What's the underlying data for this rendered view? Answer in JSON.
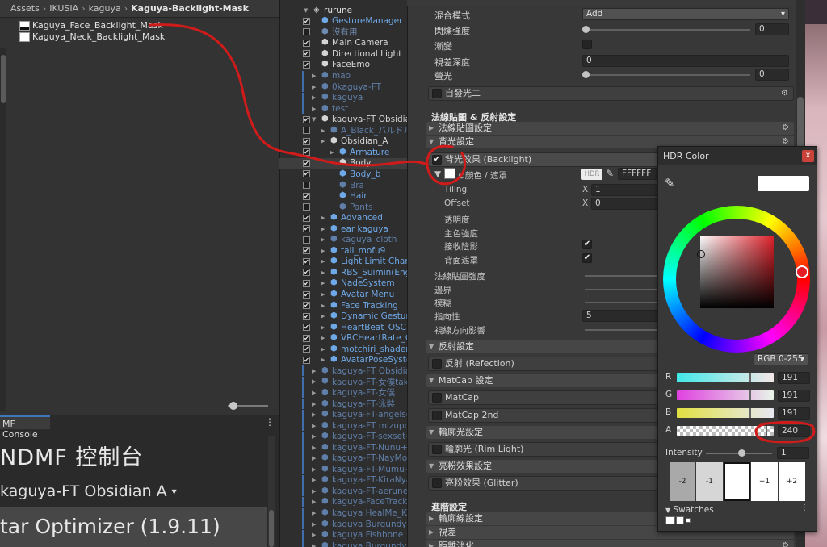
{
  "project": {
    "breadcrumb": [
      "Assets",
      "IKUSIA",
      "kaguya",
      "Kaguya-Backlight-Mask"
    ],
    "assets": [
      "Kaguya_Face_Backlight_Mask",
      "Kaguya_Neck_Backlight_Mask"
    ]
  },
  "console": {
    "tab": "MF Console",
    "title": "NDMF 控制台",
    "selected_avatar": "kaguya-FT Obsidian  A",
    "banner": "tar Optimizer (1.9.11)",
    "menu_icon": "kebab-menu-icon"
  },
  "hierarchy": {
    "root": "rurune",
    "rows": [
      {
        "label": "GestureManager",
        "color": "#6fa8e6",
        "check": true
      },
      {
        "label": "沒有用",
        "color": "#6f8bb0",
        "check": false
      },
      {
        "label": "Main Camera",
        "color": "#d4d4d4",
        "check": true
      },
      {
        "label": "Directional Light",
        "color": "#d4d4d4",
        "check": true
      },
      {
        "label": "FaceEmo",
        "color": "#d4d4d4",
        "check": true
      },
      {
        "label": "mao",
        "color": "#5f7ea8",
        "check": false
      },
      {
        "label": "0kaguya-FT",
        "color": "#5f7ea8",
        "check": false
      },
      {
        "label": "kaguya",
        "color": "#5f7ea8",
        "check": false
      },
      {
        "label": "test",
        "color": "#5f7ea8",
        "check": false
      },
      {
        "label": "kaguya-FT Obsidian",
        "color": "#d4d4d4",
        "check": true
      },
      {
        "label": "A_Black_バルドル",
        "color": "#5f7ea8",
        "check": false
      },
      {
        "label": "Obsidian_A",
        "color": "#d4d4d4",
        "check": true
      },
      {
        "label": "Armature",
        "color": "#6fa8e6",
        "check": true
      },
      {
        "label": "Body",
        "color": "#d4d4d4",
        "check": true
      },
      {
        "label": "Body_b",
        "color": "#6fa8e6",
        "check": true
      },
      {
        "label": "Bra",
        "color": "#5f7ea8",
        "check": false
      },
      {
        "label": "Hair",
        "color": "#6fa8e6",
        "check": true
      },
      {
        "label": "Pants",
        "color": "#5f7ea8",
        "check": false
      },
      {
        "label": "Advanced",
        "color": "#6fa8e6",
        "check": true
      },
      {
        "label": "ear kaguya",
        "color": "#6fa8e6",
        "check": true
      },
      {
        "label": "kaguya_cloth",
        "color": "#5f7ea8",
        "check": false
      },
      {
        "label": "tail_mofu9",
        "color": "#6fa8e6",
        "check": true
      },
      {
        "label": "Light Limit Chang",
        "color": "#6fa8e6",
        "check": true
      },
      {
        "label": "RBS_Suimin(Engl",
        "color": "#6fa8e6",
        "check": true
      },
      {
        "label": "NadeSystem",
        "color": "#6fa8e6",
        "check": true
      },
      {
        "label": "Avatar Menu",
        "color": "#6fa8e6",
        "check": true
      },
      {
        "label": "Face Tracking",
        "color": "#6fa8e6",
        "check": true
      },
      {
        "label": "Dynamic Gesture",
        "color": "#6fa8e6",
        "check": true
      },
      {
        "label": "HeartBeat_OSC",
        "color": "#6fa8e6",
        "check": true
      },
      {
        "label": "VRCHeartRate_C",
        "color": "#6fa8e6",
        "check": true
      },
      {
        "label": "motchiri_shader_S",
        "color": "#6fa8e6",
        "check": true
      },
      {
        "label": "AvatarPoseSyste",
        "color": "#6fa8e6",
        "check": true
      },
      {
        "label": "kaguya-FT Obsidia",
        "color": "#5f7ea8",
        "check": false
      },
      {
        "label": "kaguya-FT-女僕tak",
        "color": "#5f7ea8",
        "check": false
      },
      {
        "label": "kaguya-FT-女僕",
        "color": "#5f7ea8",
        "check": false
      },
      {
        "label": "kaguya-FT-泳裝",
        "color": "#5f7ea8",
        "check": false
      },
      {
        "label": "kaguya-FT-angelsc",
        "color": "#5f7ea8",
        "check": false
      },
      {
        "label": "kaguya-FT mizupoy",
        "color": "#5f7ea8",
        "check": false
      },
      {
        "label": "kaguya-FT-sexset-",
        "color": "#5f7ea8",
        "check": false
      },
      {
        "label": "kaguya-FT-Nunu+I",
        "color": "#5f7ea8",
        "check": false
      },
      {
        "label": "kaguya-FT-NayMo",
        "color": "#5f7ea8",
        "check": false
      },
      {
        "label": "kaguya-FT-Mumu-",
        "color": "#5f7ea8",
        "check": false
      },
      {
        "label": "kaguya-FT-KiraNya",
        "color": "#5f7ea8",
        "check": false
      },
      {
        "label": "kaguya-FT-aerune",
        "color": "#5f7ea8",
        "check": false
      },
      {
        "label": "kaguya-FaceTrack",
        "color": "#5f7ea8",
        "check": false
      },
      {
        "label": "kaguya HealMe_Ka",
        "color": "#5f7ea8",
        "check": false
      },
      {
        "label": "kaguya Burgundy",
        "color": "#5f7ea8",
        "check": false
      },
      {
        "label": "kaguya Fishbone",
        "color": "#5f7ea8",
        "check": false
      },
      {
        "label": "kaguya Burgundy-",
        "color": "#5f7ea8",
        "check": false
      }
    ]
  },
  "inspector": {
    "blend_mode_label": "混合模式",
    "blend_mode_value": "Add",
    "blink_label": "閃爍強度",
    "blink_value": "0",
    "fade_label": "漸變",
    "parallax_label": "視差深度",
    "parallax_value": "0",
    "fluor_label": "螢光",
    "fluor_value": "0",
    "emission2": "自發光二",
    "normal_heading": "法線貼圖 & 反射設定",
    "normal_section": "法線貼圖設定",
    "backlight_section": "背光設定",
    "backlight_toggle": "背光效果 (Backlight)",
    "color_mask_label": "顏色 / 遮罩",
    "hdr_badge": "HDR",
    "hex_value": "FFFFFF",
    "tiling_label": "Tiling",
    "tiling_x": "X",
    "tiling_value": "1",
    "offset_label": "Offset",
    "offset_x": "X",
    "offset_value": "0",
    "transparency": "透明度",
    "main_color_strength": "主色強度",
    "receive_shadow": "接收陰影",
    "back_mask": "背面遮罩",
    "normal_strength": "法線貼圖強度",
    "border": "邊界",
    "blur": "模糊",
    "directivity": "指向性",
    "directivity_value": "5",
    "view_dir_influence": "視線方向影響",
    "reflection_section": "反射設定",
    "reflection_toggle": "反射 (Refection)",
    "matcap_section": "MatCap 設定",
    "matcap": "MatCap",
    "matcap2": "MatCap 2nd",
    "rim_section": "輪廓光設定",
    "rim_toggle": "輪廓光 (Rim Light)",
    "glitter_section": "亮粉效果設定",
    "glitter_toggle": "亮粉效果 (Glitter)",
    "advanced_heading": "進階設定",
    "outline_section": "輪廓線設定",
    "parallax_section": "視差",
    "distance_section": "距離淡化"
  },
  "hdr_color": {
    "title": "HDR Color",
    "close": "x",
    "mode": "RGB 0-255",
    "r_label": "R",
    "r_value": "191",
    "g_label": "G",
    "g_value": "191",
    "b_label": "B",
    "b_value": "191",
    "a_label": "A",
    "a_value": "240",
    "intensity_label": "Intensity",
    "intensity_value": "1",
    "steps": [
      "-2",
      "-1",
      "",
      "+1",
      "+2"
    ],
    "swatches_label": "Swatches",
    "preview_color": "#ffffff",
    "hue_color": "#e31c26"
  }
}
